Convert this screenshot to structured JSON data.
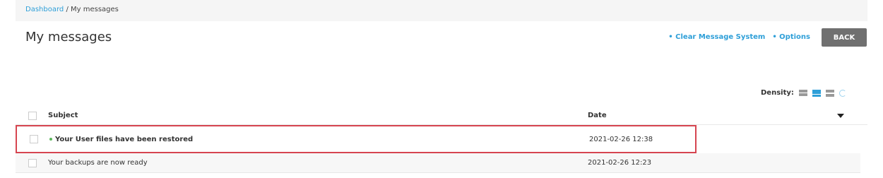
{
  "breadcrumb": {
    "dashboard": "Dashboard",
    "separator": " / ",
    "current": "My messages"
  },
  "page": {
    "title": "My messages"
  },
  "actions": {
    "clear": "• Clear Message System",
    "options": "• Options",
    "back": "BACK"
  },
  "density": {
    "label": "Density:"
  },
  "table": {
    "headers": {
      "subject": "Subject",
      "date": "Date"
    },
    "rows": [
      {
        "subject": "Your User files have been restored",
        "date": "2021-02-26 12:38"
      },
      {
        "subject": "Your backups are now ready",
        "date": "2021-02-26 12:23"
      }
    ]
  },
  "colors": {
    "accent": "#2e9fd8",
    "highlight_border": "#d64550",
    "unread": "#5cb85c",
    "back_button": "#707070"
  }
}
